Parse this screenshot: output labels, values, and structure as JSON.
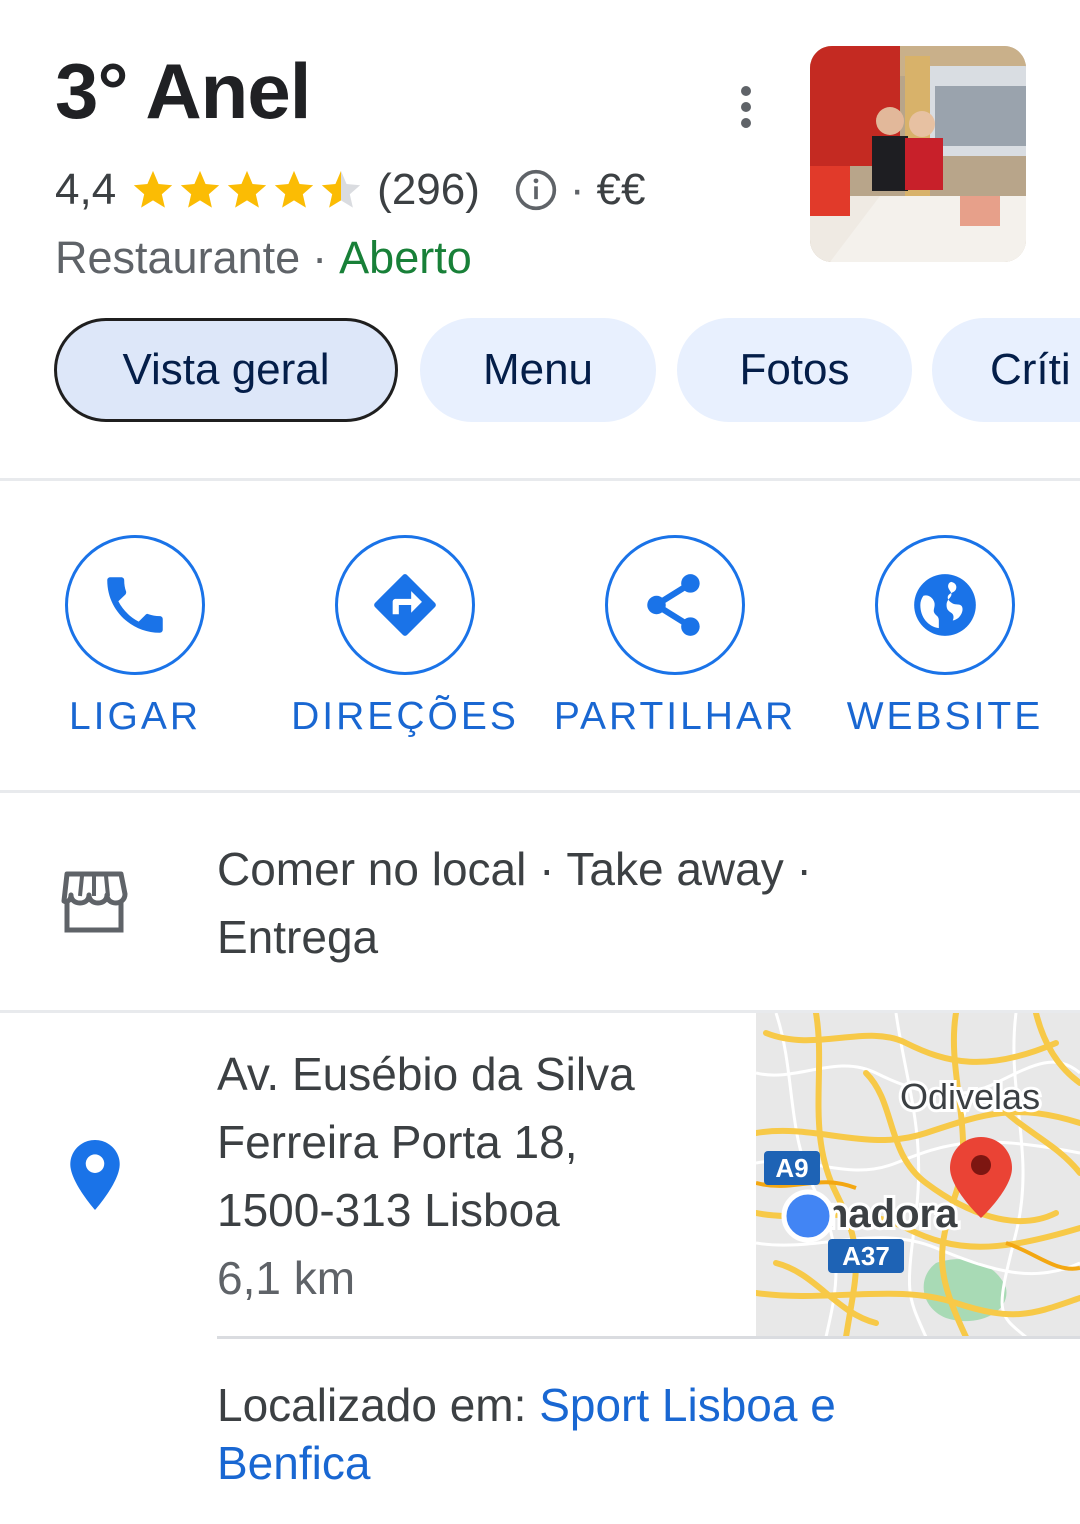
{
  "place": {
    "name": "3° Anel",
    "rating": "4,4",
    "rating_value": 4.4,
    "reviews": "(296)",
    "price": "€€",
    "category": "Restaurante",
    "status": "Aberto",
    "sep": "·"
  },
  "tabs": [
    {
      "label": "Vista geral",
      "active": true
    },
    {
      "label": "Menu"
    },
    {
      "label": "Fotos"
    },
    {
      "label": "Críti"
    }
  ],
  "actions": [
    {
      "label": "LIGAR",
      "icon": "phone-icon"
    },
    {
      "label": "DIREÇÕES",
      "icon": "directions-icon"
    },
    {
      "label": "PARTILHAR",
      "icon": "share-icon"
    },
    {
      "label": "WEBSITE",
      "icon": "globe-icon"
    }
  ],
  "services": {
    "line1": "Comer no local · Take away ·",
    "line2": "Entrega",
    "icon": "storefront-icon"
  },
  "address": {
    "line1": "Av. Eusébio da Silva",
    "line2": "Ferreira Porta 18,",
    "line3": "1500-313 Lisboa",
    "distance": "6,1 km",
    "icon": "location-pin-icon"
  },
  "map": {
    "label_odivelas": "Odivelas",
    "label_amadora": "nadora",
    "road_a9": "A9",
    "road_a37": "A37"
  },
  "located": {
    "prefix": "Localizado em: ",
    "link_line1": "Sport Lisboa e",
    "link_line2": "Benfica"
  },
  "colors": {
    "accent": "#1a73e8",
    "star": "#fbbc04",
    "open": "#188038",
    "tab_bg": "#e8f0fe"
  }
}
